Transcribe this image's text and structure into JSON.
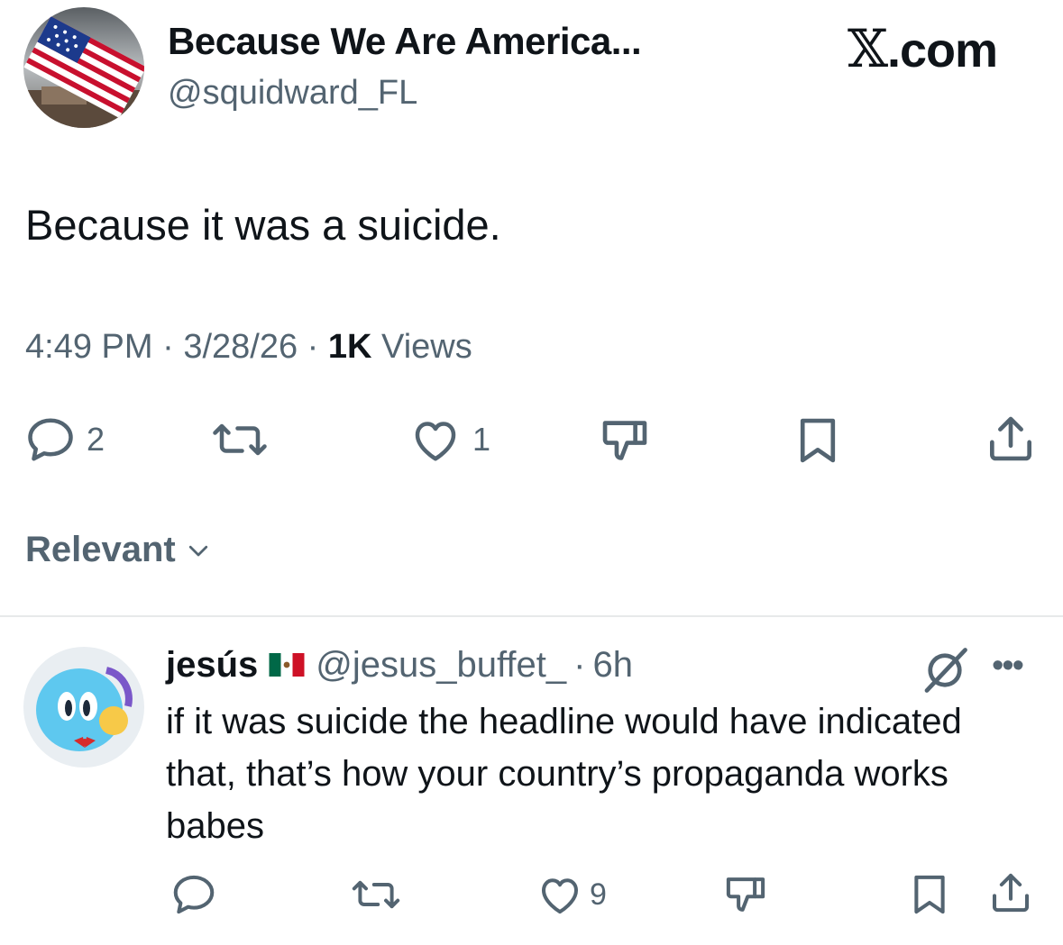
{
  "tweet": {
    "display_name": "Because We Are America...",
    "handle": "@squidward_FL",
    "text": "Because it was a suicide.",
    "time": "4:49 PM",
    "date": "3/28/26",
    "separator": "·",
    "views_count": "1K",
    "views_label": "Views",
    "avatar_icon": "american-flag-avatar",
    "actions": {
      "reply_icon": "reply-icon",
      "reply_count": "2",
      "retweet_icon": "retweet-icon",
      "like_icon": "heart-icon",
      "like_count": "1",
      "dislike_icon": "thumbs-down-icon",
      "bookmark_icon": "bookmark-icon",
      "share_icon": "share-icon"
    }
  },
  "brand": {
    "mark": "𝕏",
    "suffix": ".com"
  },
  "sort": {
    "label": "Relevant",
    "icon": "chevron-down-icon"
  },
  "reply": {
    "display_name": "jesús",
    "flag_icon": "mexico-flag-icon",
    "handle": "@jesus_buffet_",
    "separator": "·",
    "age": "6h",
    "text": "if it was suicide the headline would have indicated that, that’s how your country’s propaganda works babes",
    "avatar_icon": "cartoon-avatar",
    "menu_icon": "more-icon",
    "grok_icon": "grok-icon",
    "more_label": "•••",
    "actions": {
      "reply_icon": "reply-icon",
      "retweet_icon": "retweet-icon",
      "like_icon": "heart-icon",
      "like_count": "9",
      "dislike_icon": "thumbs-down-icon",
      "bookmark_icon": "bookmark-icon",
      "share_icon": "share-icon"
    }
  },
  "colors": {
    "text_primary": "#0f1419",
    "text_secondary": "#536471",
    "divider": "#e7e9ea"
  }
}
